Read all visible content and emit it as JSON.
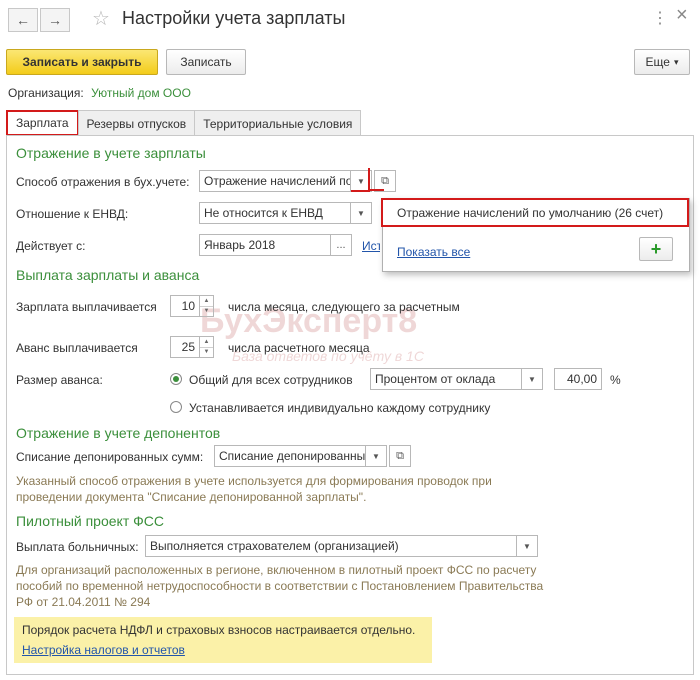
{
  "window": {
    "title": "Настройки учета зарплаты",
    "back_icon": "←",
    "forward_icon": "→",
    "star_icon": "☆",
    "menu_icon": "⋮",
    "close_icon": "×"
  },
  "toolbar": {
    "save_close_label": "Записать и закрыть",
    "save_label": "Записать",
    "more_label": "Еще",
    "more_arrow": "▾",
    "help_label": "?"
  },
  "organization": {
    "label": "Организация:",
    "value": "Уютный дом ООО"
  },
  "tabs": [
    {
      "label": "Зарплата",
      "active": true
    },
    {
      "label": "Резервы отпусков",
      "active": false
    },
    {
      "label": "Территориальные условия",
      "active": false
    }
  ],
  "accounting": {
    "section_title": "Отражение в учете зарплаты",
    "method_label": "Способ отражения в бух.учете:",
    "method_value": "Отражение начислений по умолчанию (26 счет)",
    "envd_label": "Отношение к ЕНВД:",
    "envd_value": "Не относится к ЕНВД",
    "effective_label": "Действует с:",
    "effective_value": "Январь 2018",
    "history_link": "История"
  },
  "popup": {
    "item_label": "Отражение начислений по умолчанию (26 счет)",
    "show_all_label": "Показать все",
    "add_label": "+"
  },
  "payment": {
    "section_title": "Выплата зарплаты и аванса",
    "salary_label": "Зарплата выплачивается",
    "salary_day": "10",
    "salary_suffix": "числа месяца, следующего за расчетным",
    "advance_label": "Аванс выплачивается",
    "advance_day": "25",
    "advance_suffix": "числа расчетного месяца",
    "advance_size_label": "Размер аванса:",
    "common_option": "Общий для всех сотрудников",
    "common_selected": true,
    "calc_method_value": "Процентом от оклада",
    "percent_value": "40,00",
    "percent_sign": "%",
    "individual_option": "Устанавливается индивидуально каждому сотруднику"
  },
  "deposits": {
    "section_title": "Отражение в учете депонентов",
    "writeoff_label": "Списание депонированных сумм:",
    "writeoff_value": "Списание депонированных сумм",
    "note": "Указанный способ отражения в учете используется для формирования проводок при проведении документа \"Списание депонированной зарплаты\"."
  },
  "fss": {
    "section_title": "Пилотный проект ФСС",
    "sick_label": "Выплата больничных:",
    "sick_value": "Выполняется страхователем (организацией)",
    "note": "Для организаций расположенных в регионе, включенном в пилотный проект ФСС по расчету пособий по временной нетрудоспособности в соответствии с Постановлением Правительства РФ от 21.04.2011 № 294"
  },
  "notice": {
    "text": "Порядок расчета НДФЛ и страховых взносов настраивается отдельно.",
    "link": "Настройка налогов и отчетов"
  },
  "watermark": {
    "title": "БухЭксперт8",
    "subtitle": "База ответов по учёту в 1С"
  },
  "colors": {
    "section_green": "#3b8f3b",
    "primary_yellow": "#f3cc1a",
    "highlight_red": "#d31a1a",
    "notice_yellow": "#fbf1a8",
    "link_blue": "#2255aa"
  }
}
